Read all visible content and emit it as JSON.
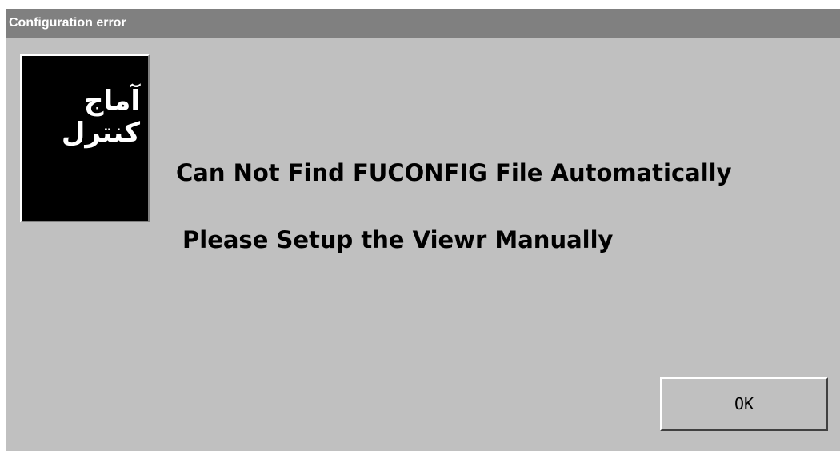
{
  "window": {
    "title": "Configuration error"
  },
  "logo": {
    "line1": "آماج",
    "line2": "کنترل"
  },
  "message": {
    "line1": "Can Not Find FUCONFIG File Automatically",
    "line2": "Please Setup the Viewr Manually"
  },
  "buttons": {
    "ok_label": "OK"
  }
}
